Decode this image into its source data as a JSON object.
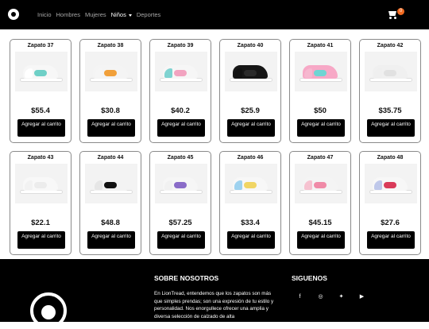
{
  "nav": {
    "links": [
      "Inicio",
      "Hombres",
      "Mujeres",
      "Niños",
      "Deportes"
    ],
    "cart_count": "0"
  },
  "products": [
    {
      "name": "Zapato 37",
      "price": "$55.4",
      "button": "Agregar al carrito",
      "upper": "#f7f7f7",
      "accent": "#6fd0c7",
      "heel": "#ffffff"
    },
    {
      "name": "Zapato 38",
      "price": "$30.8",
      "button": "Agregar al carrito",
      "upper": "#f4f4f4",
      "accent": "#f1a03a",
      "heel": "#f5f5f5"
    },
    {
      "name": "Zapato 39",
      "price": "$40.2",
      "button": "Agregar al carrito",
      "upper": "#f6f6f6",
      "accent": "#f2a3c0",
      "heel": "#7fd3d1"
    },
    {
      "name": "Zapato 40",
      "price": "$25.9",
      "button": "Agregar al carrito",
      "upper": "#161616",
      "accent": "#2a2a2a",
      "heel": "#111111"
    },
    {
      "name": "Zapato 41",
      "price": "$50",
      "button": "Agregar al carrito",
      "upper": "#f7a8c6",
      "accent": "#6fd5d3",
      "heel": "#f6b7cf"
    },
    {
      "name": "Zapato 42",
      "price": "$35.75",
      "button": "Agregar al carrito",
      "upper": "#f0f0f0",
      "accent": "#e1e1e1",
      "heel": "#efefef"
    },
    {
      "name": "Zapato 43",
      "price": "$22.1",
      "button": "Agregar al carrito",
      "upper": "#f8f8f8",
      "accent": "#ececec",
      "heel": "#f2f2f2"
    },
    {
      "name": "Zapato 44",
      "price": "$48.8",
      "button": "Agregar al carrito",
      "upper": "#f3f3f3",
      "accent": "#111111",
      "heel": "#e6e6e6"
    },
    {
      "name": "Zapato 45",
      "price": "$57.25",
      "button": "Agregar al carrito",
      "upper": "#f6f6f6",
      "accent": "#8a6cc8",
      "heel": "#f1f1f1"
    },
    {
      "name": "Zapato 46",
      "price": "$33.4",
      "button": "Agregar al carrito",
      "upper": "#f7f7f7",
      "accent": "#f0d564",
      "heel": "#9ed2ef"
    },
    {
      "name": "Zapato 47",
      "price": "$45.15",
      "button": "Agregar al carrito",
      "upper": "#f4f4f4",
      "accent": "#f08aa7",
      "heel": "#f6c2d0"
    },
    {
      "name": "Zapato 48",
      "price": "$27.6",
      "button": "Agregar al carrito",
      "upper": "#f7f7f7",
      "accent": "#d93b5a",
      "heel": "#bfc8ea"
    }
  ],
  "footer": {
    "about_title": "SOBRE NOSOTROS",
    "about_text": "En LionTread, entendemos que los zapatos son más que simples prendas; son una expresión de tu estilo y personalidad. Nos enorgullece ofrecer una amplia y diversa selección de calzado de alta",
    "social_title": "SIGUENOS",
    "social_icons": [
      "facebook-icon",
      "instagram-icon",
      "twitter-icon",
      "youtube-icon"
    ]
  },
  "colors": {
    "badge": "#f26b21",
    "navbar": "#000000",
    "button": "#000000"
  }
}
